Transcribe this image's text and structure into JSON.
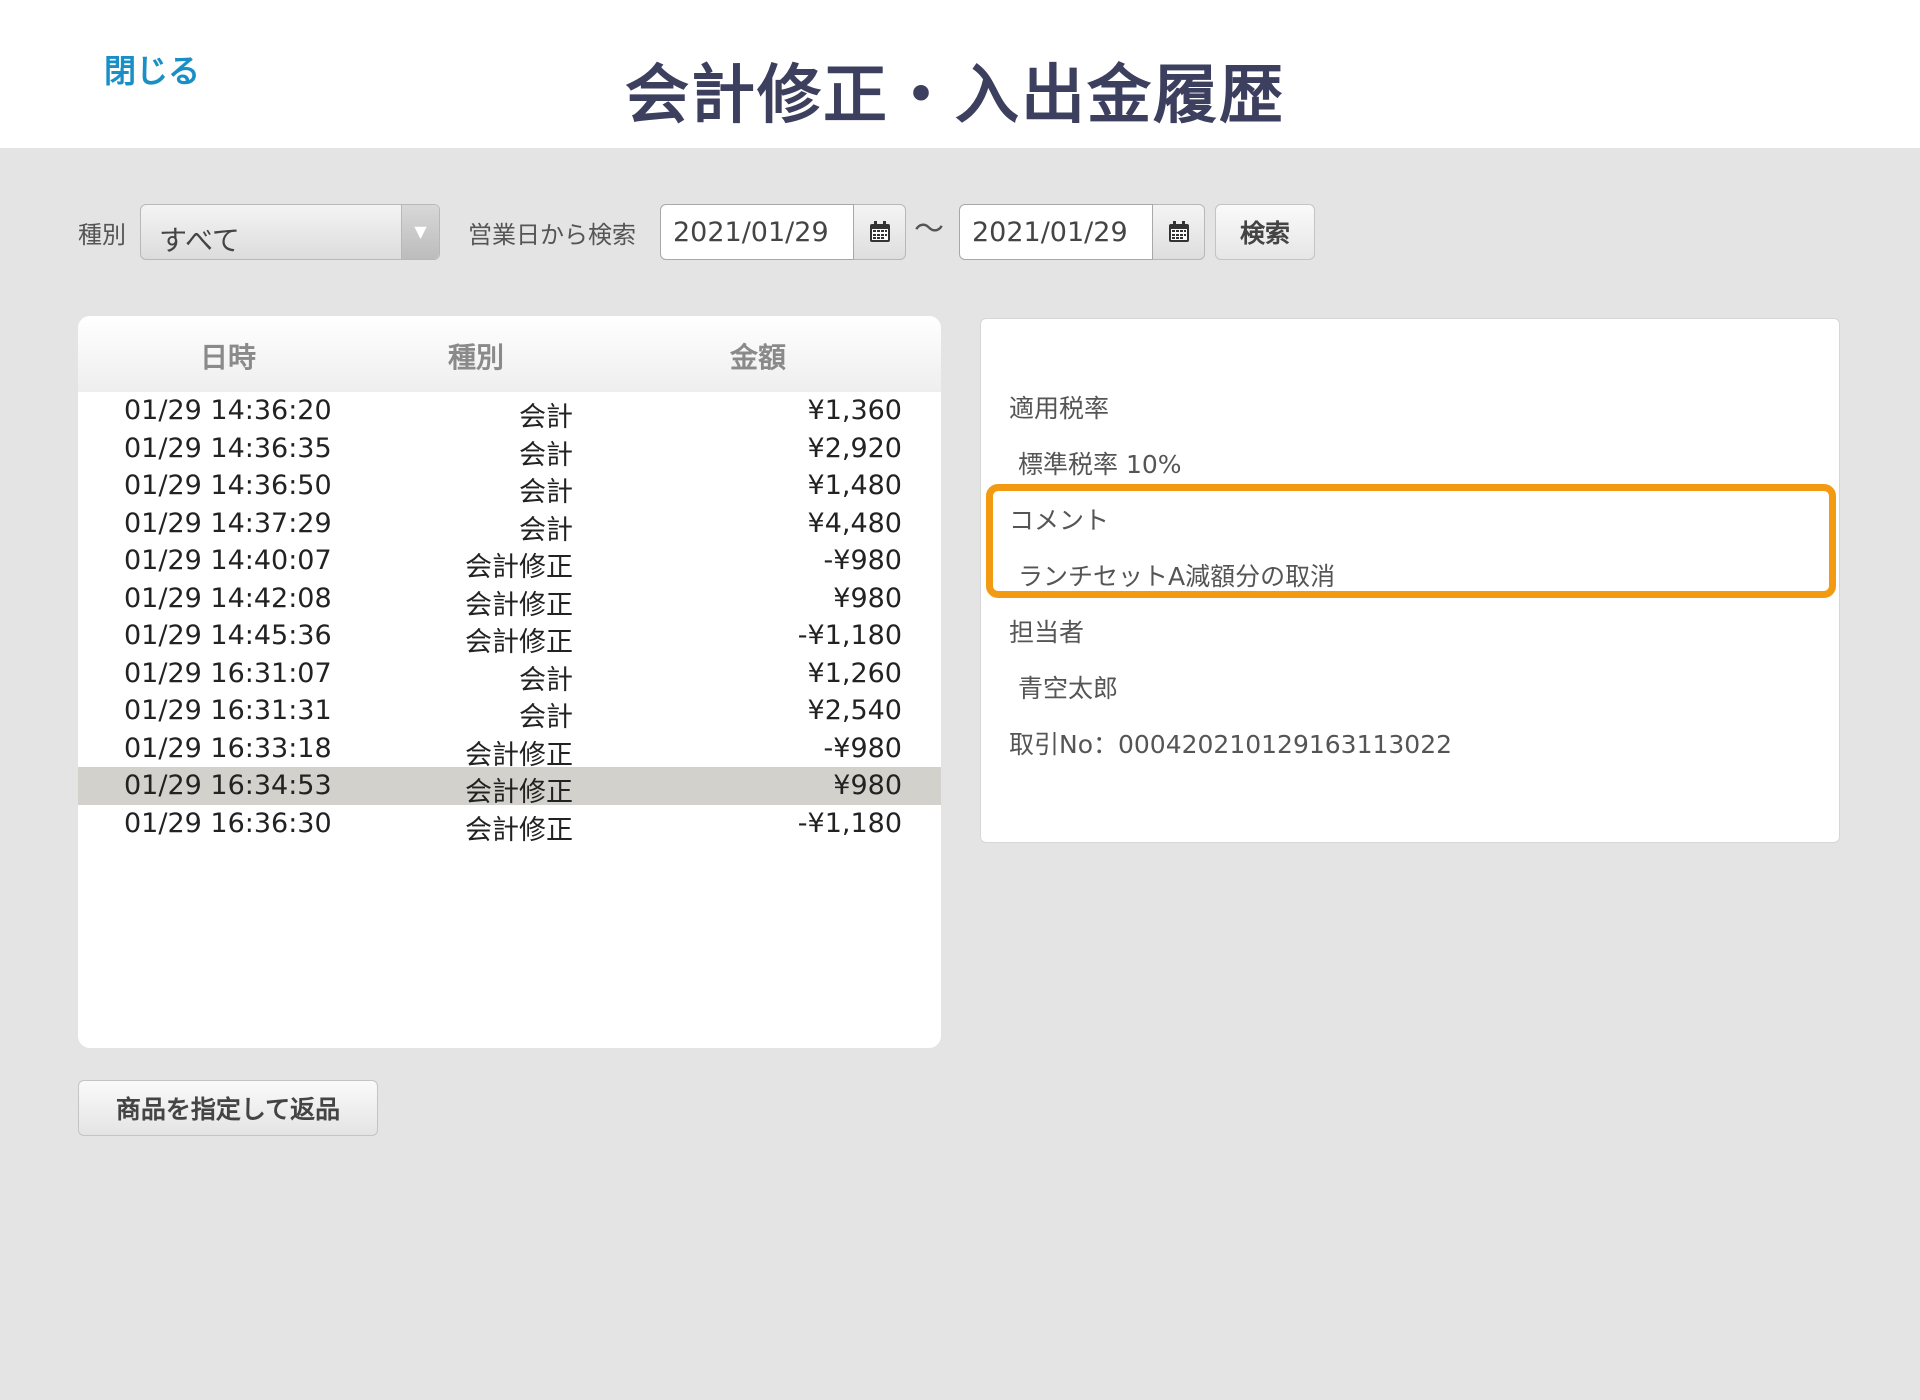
{
  "header": {
    "close_label": "閉じる",
    "title": "会計修正・入出金履歴"
  },
  "filters": {
    "type_label": "種別",
    "type_value": "すべて",
    "business_day_label": "営業日から検索",
    "date_from": "2021/01/29",
    "range_separator": "〜",
    "date_to": "2021/01/29",
    "search_label": "検索"
  },
  "history": {
    "columns": [
      "日時",
      "種別",
      "金額"
    ],
    "rows": [
      {
        "datetime": "01/29 14:36:20",
        "type": "会計",
        "amount": "¥1,360"
      },
      {
        "datetime": "01/29 14:36:35",
        "type": "会計",
        "amount": "¥2,920"
      },
      {
        "datetime": "01/29 14:36:50",
        "type": "会計",
        "amount": "¥1,480"
      },
      {
        "datetime": "01/29 14:37:29",
        "type": "会計",
        "amount": "¥4,480"
      },
      {
        "datetime": "01/29 14:40:07",
        "type": "会計修正",
        "amount": "-¥980"
      },
      {
        "datetime": "01/29 14:42:08",
        "type": "会計修正",
        "amount": "¥980"
      },
      {
        "datetime": "01/29 14:45:36",
        "type": "会計修正",
        "amount": "-¥1,180"
      },
      {
        "datetime": "01/29 16:31:07",
        "type": "会計",
        "amount": "¥1,260"
      },
      {
        "datetime": "01/29 16:31:31",
        "type": "会計",
        "amount": "¥2,540"
      },
      {
        "datetime": "01/29 16:33:18",
        "type": "会計修正",
        "amount": "-¥980"
      },
      {
        "datetime": "01/29 16:34:53",
        "type": "会計修正",
        "amount": "¥980"
      },
      {
        "datetime": "01/29 16:36:30",
        "type": "会計修正",
        "amount": "-¥1,180"
      }
    ],
    "selected_index": 10
  },
  "detail": {
    "tax_rate_label": "適用税率",
    "tax_rate_value": "標準税率 10%",
    "comment_label": "コメント",
    "comment_value": "ランチセットA減額分の取消",
    "staff_label": "担当者",
    "staff_value": "青空太郎",
    "transaction_no": "取引No：00042021012916311302​2"
  },
  "actions": {
    "return_label": "商品を指定して返品"
  },
  "colors": {
    "accent_link": "#1a8fc6",
    "title": "#3d3f5e",
    "highlight": "#f39a13",
    "selected_row": "#d2d1cc"
  },
  "icons": {
    "calendar": "calendar-icon",
    "dropdown": "chevron-down-icon"
  }
}
